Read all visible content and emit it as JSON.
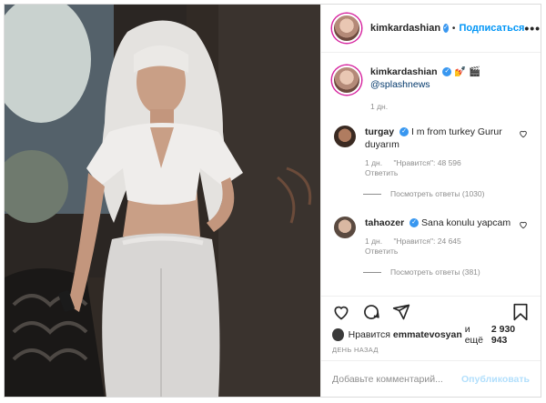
{
  "header": {
    "username": "kimkardashian",
    "verified_mark": "✓",
    "separator": "•",
    "follow_label": "Подписаться",
    "more_label": "•••"
  },
  "caption": {
    "username": "kimkardashian",
    "emoji": "💅 🎬",
    "mention": "@splashnews",
    "time": "1 дн."
  },
  "comments": [
    {
      "username": "turgay",
      "text": "I m from turkey Gurur duyarım",
      "time": "1 дн.",
      "likes": "\"Нравится\": 48 596",
      "reply": "Ответить",
      "view_replies": "Посмотреть ответы (1030)"
    },
    {
      "username": "tahaozer",
      "text": "Sana konulu yapcam",
      "time": "1 дн.",
      "likes": "\"Нравится\": 24 645",
      "reply": "Ответить",
      "view_replies": "Посмотреть ответы (381)"
    }
  ],
  "icons": [
    "heart-icon",
    "comment-icon",
    "share-icon",
    "bookmark-icon"
  ],
  "likes": {
    "prefix": "Нравится",
    "user": "emmatevosyan",
    "suffix": "и ещё",
    "count": "2 930 943"
  },
  "posted": "ДЕНЬ НАЗАД",
  "add_comment": {
    "placeholder": "Добавьте комментарий...",
    "publish_label": "Опубликовать"
  },
  "colors": {
    "accent": "#0095f6",
    "verified": "#3897f0",
    "muted": "#8e8e8e"
  }
}
